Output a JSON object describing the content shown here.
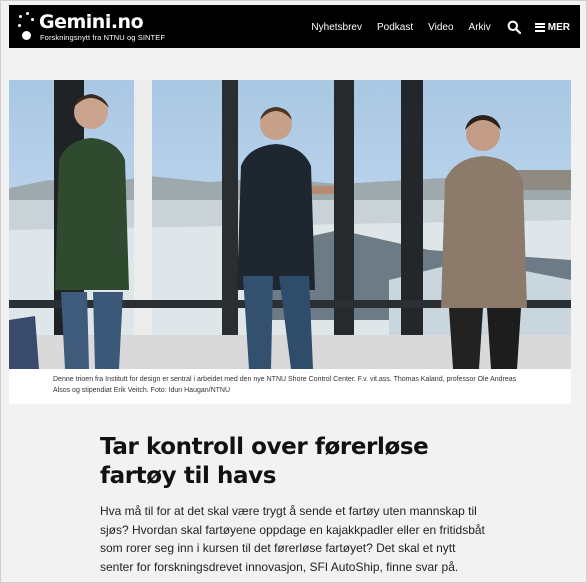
{
  "header": {
    "brand": "Gemini.no",
    "tagline": "Forskningsnytt fra NTNU og SINTEF",
    "nav": [
      "Nyhetsbrev",
      "Podkast",
      "Video",
      "Arkiv"
    ],
    "search_icon": "search-icon",
    "menu_icon": "hamburger-icon",
    "menu_label": "MER"
  },
  "hero": {
    "caption": "Denne trioen fra Institutt for design er sentral i arbeidet med den nye NTNU Shore Control Center. F.v. vit.ass. Thomas Kaland, professor Ole Andreas Alsos og stipendiat Erik Veitch. Foto: Idun Haugan/NTNU"
  },
  "article": {
    "title": "Tar kontroll over førerløse fartøy til havs",
    "lead": "Hva må til for at det skal være trygt å sende et fartøy uten mannskap til sjøs? Hvordan skal fartøyene oppdage en kajakkpadler eller en fritidsbåt som rorer seg inn i kursen til det førerløse fartøyet? Det skal et nytt senter for forskningsdrevet innovasjon, SFI AutoShip, finne svar på."
  },
  "colors": {
    "header_bg": "#000000",
    "page_bg": "#f2f2f2",
    "text": "#111111"
  }
}
